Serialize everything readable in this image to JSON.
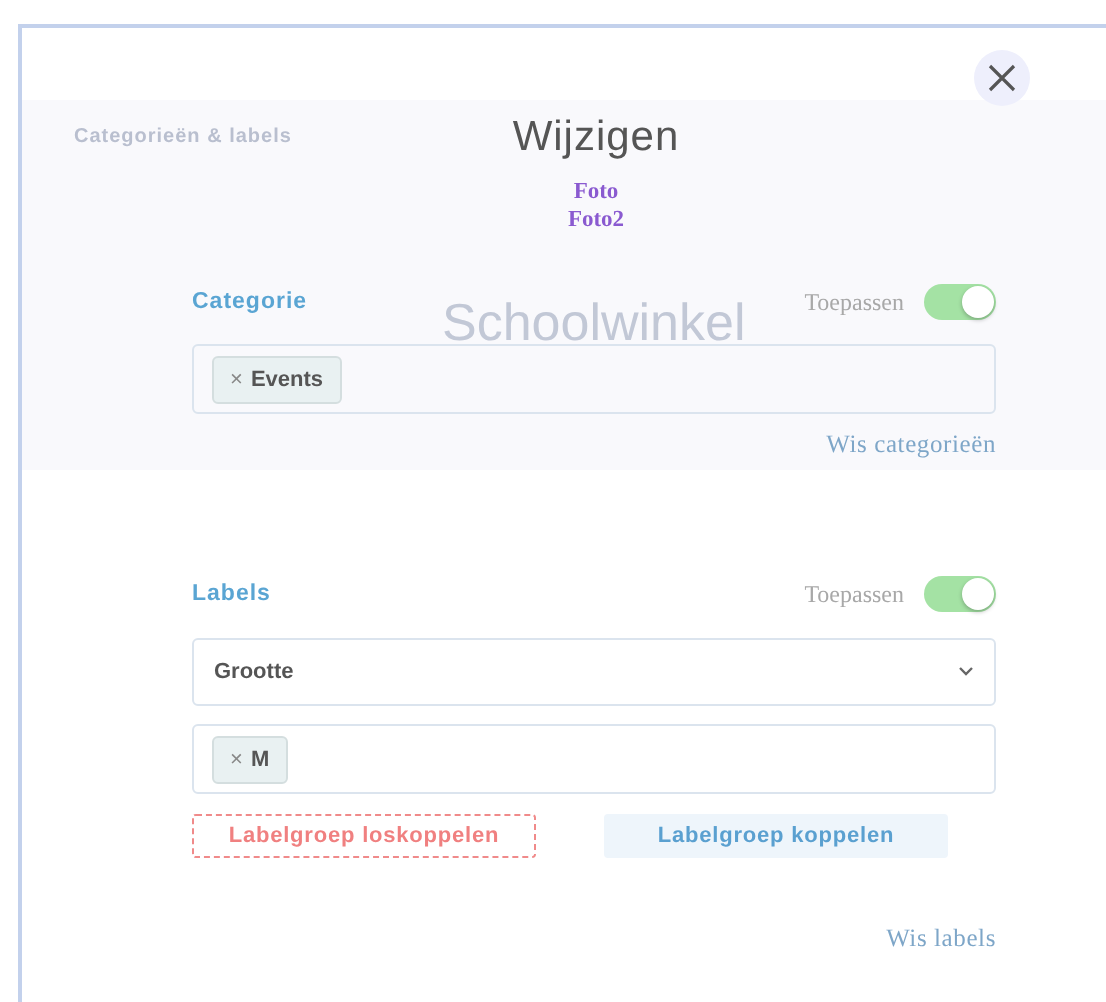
{
  "background": {
    "heading": "Categorieën & labels",
    "logo": "Schoolwinkel"
  },
  "dialog": {
    "title": "Wijzigen",
    "items": [
      "Foto",
      "Foto2"
    ]
  },
  "category": {
    "heading": "Categorie",
    "apply": {
      "label": "Toepassen",
      "on": true
    },
    "tags": [
      {
        "label": "Events",
        "remove": "×"
      }
    ],
    "clear": "Wis categorieën"
  },
  "labels": {
    "heading": "Labels",
    "apply": {
      "label": "Toepassen",
      "on": true
    },
    "group_select": {
      "value": "Grootte"
    },
    "tags": [
      {
        "label": "M",
        "remove": "×"
      }
    ],
    "unlink_button": "Labelgroep loskoppelen",
    "link_button": "Labelgroep koppelen",
    "clear": "Wis labels"
  }
}
